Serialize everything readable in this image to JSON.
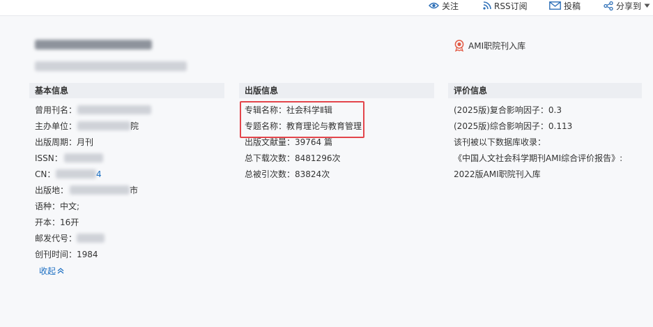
{
  "toolbar": {
    "follow": "关注",
    "rss": "RSS订阅",
    "submit": "投稿",
    "share": "分享到"
  },
  "badge": {
    "label": "AMI职院刊入库"
  },
  "basic": {
    "title": "基本信息",
    "former_name_label": "曾用刊名：",
    "sponsor_label": "主办单位：",
    "sponsor_suffix": "院",
    "cycle_label": "出版周期：",
    "cycle_value": "月刊",
    "issn_label": "ISSN：",
    "cn_label": "CN：",
    "cn_suffix": "4",
    "place_label": "出版地：",
    "place_suffix": "市",
    "lang_label": "语种：",
    "lang_value": "中文;",
    "format_label": "开本：",
    "format_value": "16开",
    "postal_label": "邮发代号：",
    "founded_label": "创刊时间：",
    "founded_value": "1984",
    "collapse": "收起"
  },
  "pub": {
    "title": "出版信息",
    "series_label": "专辑名称：",
    "series_value": "社会科学Ⅱ辑",
    "topic_label": "专题名称：",
    "topic_value": "教育理论与教育管理",
    "count_label": "出版文献量：",
    "count_value": "39764 篇",
    "downloads_label": "总下载次数：",
    "downloads_value": "8481296次",
    "cites_label": "总被引次数：",
    "cites_value": "83824次"
  },
  "eval": {
    "title": "评价信息",
    "composite_label": "(2025版)复合影响因子：",
    "composite_value": "0.3",
    "overall_label": "(2025版)综合影响因子：",
    "overall_value": "0.113",
    "db_label": "该刊被以下数据库收录：",
    "report": "《中国人文社会科学期刊AMI综合评价报告》:",
    "edition": "2022版AMI职院刊入库"
  },
  "colors": {
    "highlight": "#e3454b",
    "link": "#1b6ec2",
    "icon": "#2d6fb7"
  }
}
